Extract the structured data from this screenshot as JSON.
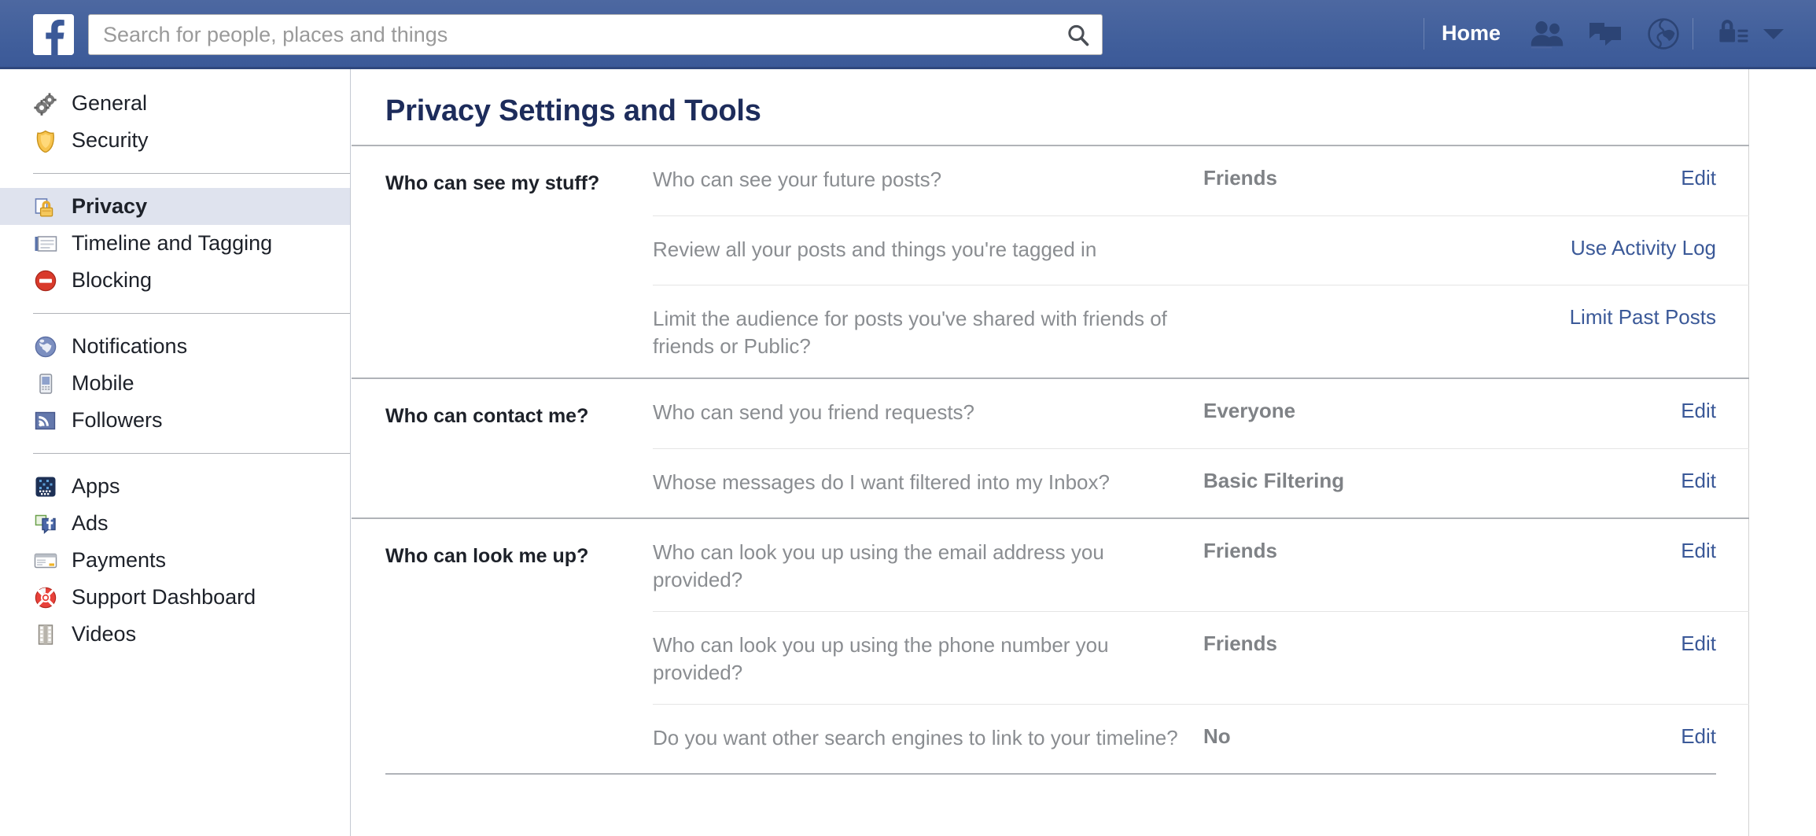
{
  "header": {
    "logo_icon": "facebook-f-logo",
    "search": {
      "placeholder": "Search for people, places and things",
      "value": "",
      "icon": "search-icon"
    },
    "home_label": "Home",
    "icons": [
      {
        "name": "friend-requests-icon"
      },
      {
        "name": "messages-icon"
      },
      {
        "name": "notifications-globe-icon"
      },
      {
        "name": "privacy-shortcuts-lock-icon"
      },
      {
        "name": "account-settings-caret-icon"
      }
    ]
  },
  "sidebar": {
    "groups": [
      {
        "items": [
          {
            "label": "General",
            "icon": "gears-icon",
            "selected": false
          },
          {
            "label": "Security",
            "icon": "shield-icon",
            "selected": false
          }
        ]
      },
      {
        "items": [
          {
            "label": "Privacy",
            "icon": "privacy-lock-icon",
            "selected": true
          },
          {
            "label": "Timeline and Tagging",
            "icon": "timeline-icon",
            "selected": false
          },
          {
            "label": "Blocking",
            "icon": "blocking-no-entry-icon",
            "selected": false
          }
        ]
      },
      {
        "items": [
          {
            "label": "Notifications",
            "icon": "globe-icon",
            "selected": false
          },
          {
            "label": "Mobile",
            "icon": "mobile-phone-icon",
            "selected": false
          },
          {
            "label": "Followers",
            "icon": "rss-followers-icon",
            "selected": false
          }
        ]
      },
      {
        "items": [
          {
            "label": "Apps",
            "icon": "apps-grid-icon",
            "selected": false
          },
          {
            "label": "Ads",
            "icon": "ads-icon",
            "selected": false
          },
          {
            "label": "Payments",
            "icon": "credit-card-icon",
            "selected": false
          },
          {
            "label": "Support Dashboard",
            "icon": "life-ring-icon",
            "selected": false
          },
          {
            "label": "Videos",
            "icon": "film-strip-icon",
            "selected": false
          }
        ]
      }
    ]
  },
  "main": {
    "title": "Privacy Settings and Tools",
    "sections": [
      {
        "title": "Who can see my stuff?",
        "rows": [
          {
            "question": "Who can see your future posts?",
            "value": "Friends",
            "action": "Edit"
          },
          {
            "question": "Review all your posts and things you're tagged in",
            "value": "",
            "action": "Use Activity Log"
          },
          {
            "question": "Limit the audience for posts you've shared with friends of friends or Public?",
            "value": "",
            "action": "Limit Past Posts"
          }
        ]
      },
      {
        "title": "Who can contact me?",
        "rows": [
          {
            "question": "Who can send you friend requests?",
            "value": "Everyone",
            "action": "Edit"
          },
          {
            "question": "Whose messages do I want filtered into my Inbox?",
            "value": "Basic Filtering",
            "action": "Edit"
          }
        ]
      },
      {
        "title": "Who can look me up?",
        "rows": [
          {
            "question": "Who can look you up using the email address you provided?",
            "value": "Friends",
            "action": "Edit"
          },
          {
            "question": "Who can look you up using the phone number you provided?",
            "value": "Friends",
            "action": "Edit"
          },
          {
            "question": "Do you want other search engines to link to your timeline?",
            "value": "No",
            "action": "Edit"
          }
        ]
      }
    ]
  },
  "colors": {
    "brand_blue": "#3b5998",
    "link_blue": "#3b5998",
    "title_navy": "#1d2c5b",
    "selected_row": "#dfe3ee",
    "muted_text": "#8a8d91"
  }
}
